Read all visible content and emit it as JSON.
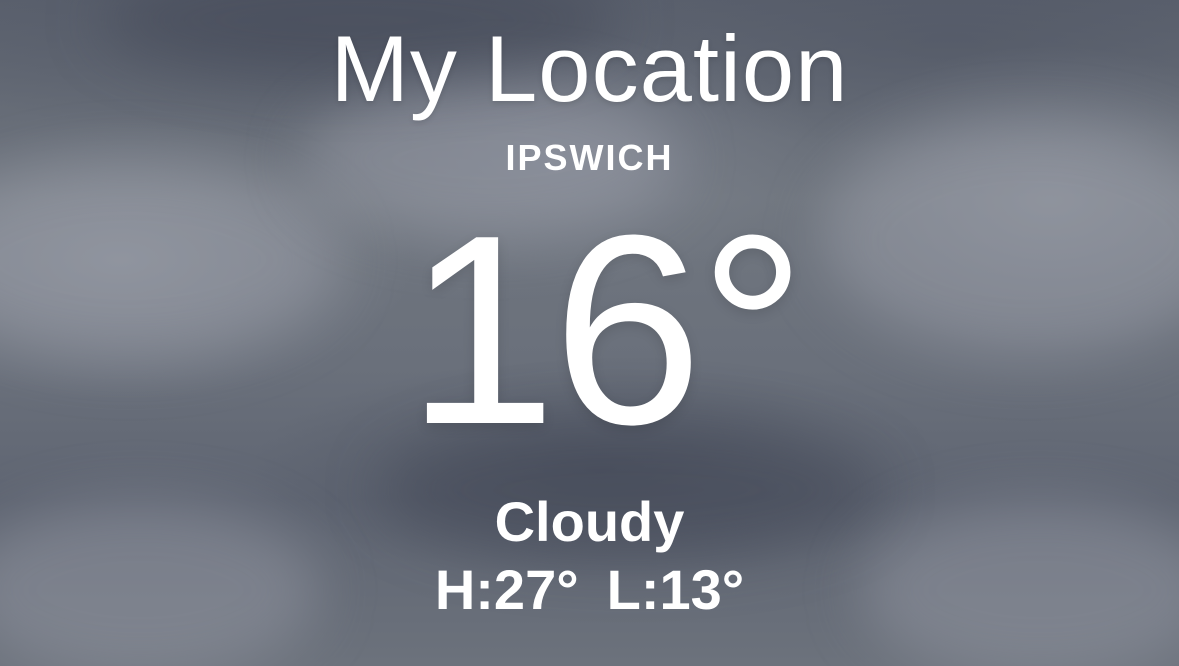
{
  "header": {
    "title": "My Location",
    "city": "IPSWICH"
  },
  "current": {
    "temperature": "16°",
    "condition": "Cloudy",
    "high": "H:27°",
    "low": "L:13°"
  },
  "colors": {
    "text": "#ffffff",
    "sky": "#6a707c"
  }
}
